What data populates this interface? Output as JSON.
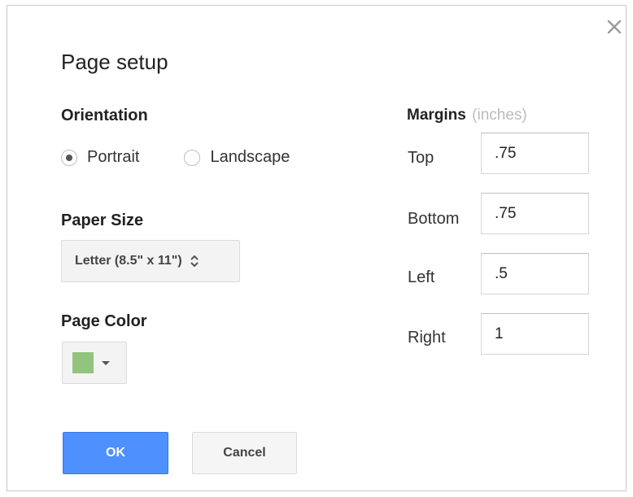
{
  "dialog": {
    "title": "Page setup",
    "close_icon": "close-icon"
  },
  "orientation": {
    "label": "Orientation",
    "options": [
      {
        "label": "Portrait",
        "selected": true
      },
      {
        "label": "Landscape",
        "selected": false
      }
    ]
  },
  "paper_size": {
    "label": "Paper Size",
    "selected": "Letter (8.5\" x 11\")"
  },
  "page_color": {
    "label": "Page Color",
    "value": "#93c47d"
  },
  "margins": {
    "label": "Margins",
    "unit": "(inches)",
    "fields": [
      {
        "label": "Top",
        "value": ".75"
      },
      {
        "label": "Bottom",
        "value": ".75"
      },
      {
        "label": "Left",
        "value": ".5"
      },
      {
        "label": "Right",
        "value": "1"
      }
    ]
  },
  "buttons": {
    "ok": "OK",
    "cancel": "Cancel"
  },
  "colors": {
    "primary": "#4d90fe",
    "swatch": "#93c47d"
  }
}
